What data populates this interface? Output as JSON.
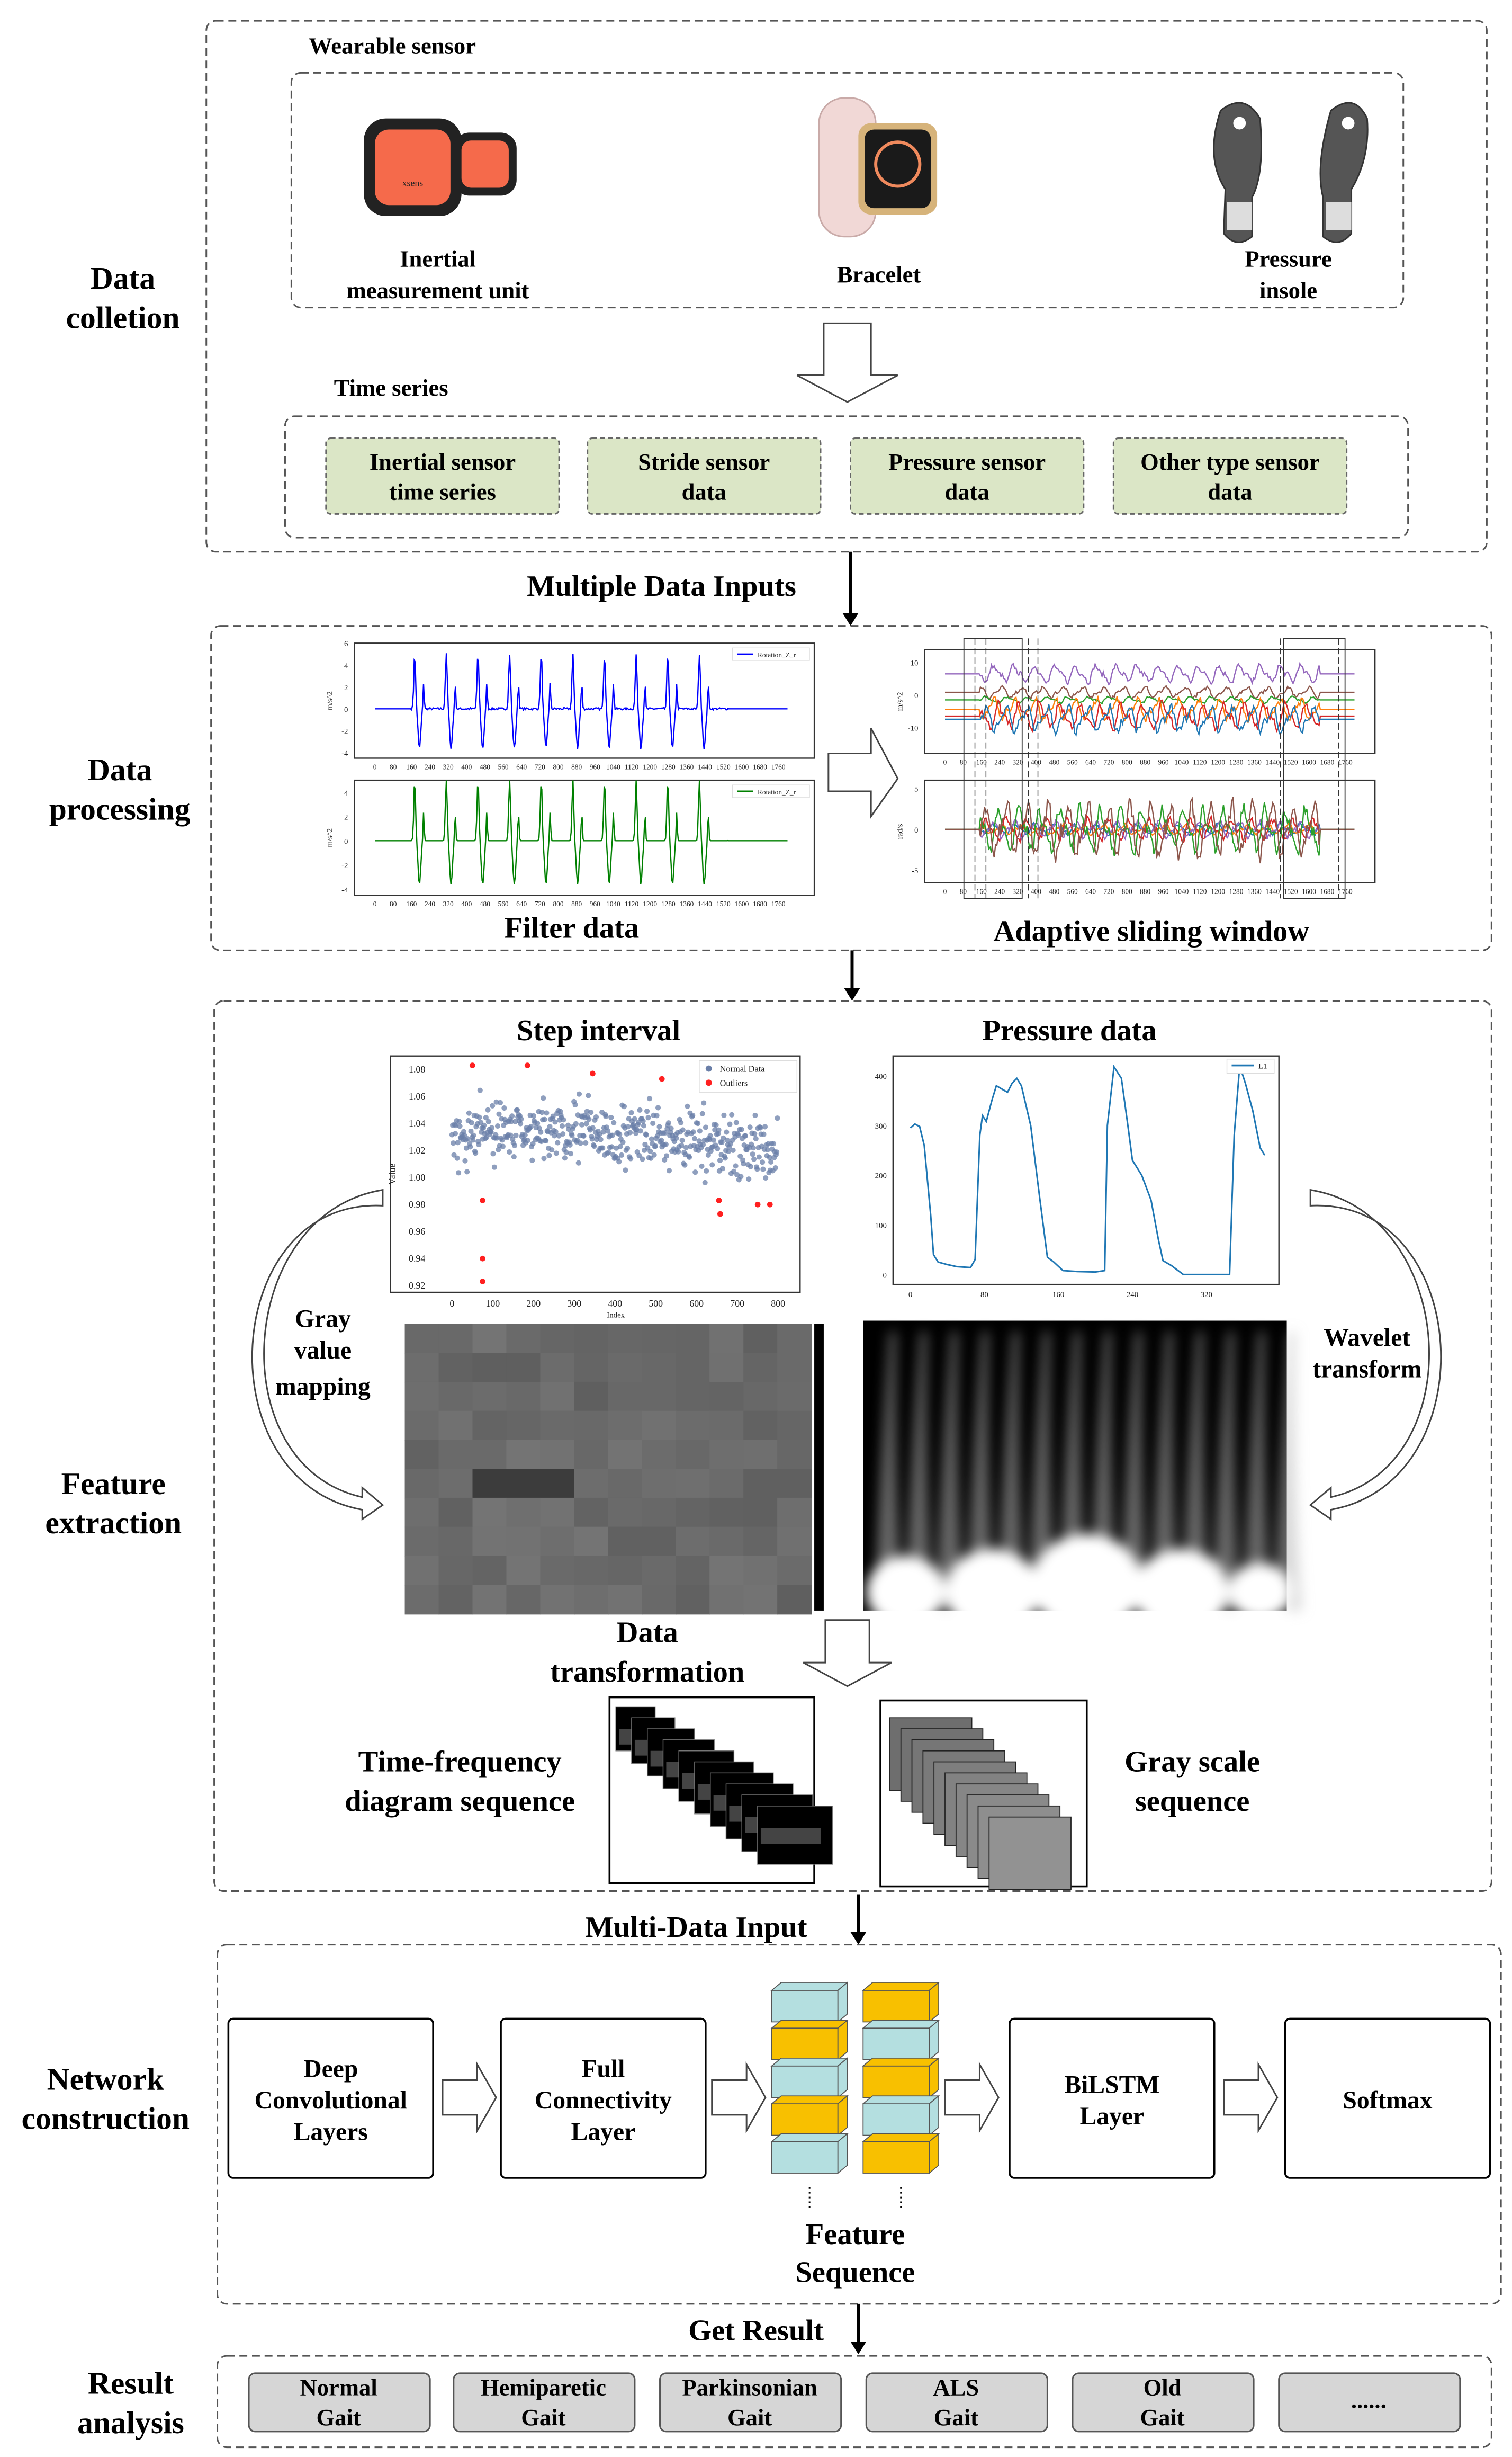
{
  "sections": {
    "collection": {
      "label": [
        "Data",
        "colletion"
      ],
      "wearable_title": "Wearable sensor",
      "time_series_title": "Time series",
      "devices": [
        {
          "icon": "imu-sensor-icon",
          "label": [
            "Inertial",
            "measurement unit"
          ],
          "brand": "xsens"
        },
        {
          "icon": "bracelet-icon",
          "label": [
            "Bracelet"
          ]
        },
        {
          "icon": "pressure-insole-icon",
          "label": [
            "Pressure",
            "insole"
          ]
        }
      ],
      "series": [
        [
          "Inertial sensor",
          "time series"
        ],
        [
          "Stride sensor",
          "data"
        ],
        [
          "Pressure sensor",
          "data"
        ],
        [
          "Other type sensor",
          "data"
        ]
      ]
    },
    "inputs_label": "Multiple Data Inputs",
    "processing": {
      "label": [
        "Data",
        "processing"
      ],
      "filter_label": "Filter data",
      "window_label": "Adaptive sliding window"
    },
    "feature": {
      "label": [
        "Feature",
        "extraction"
      ],
      "step_title": "Step interval",
      "pressure_title": "Pressure data",
      "gray_mapping": [
        "Gray",
        "value",
        "mapping"
      ],
      "wavelet": [
        "Wavelet",
        "transform"
      ],
      "transformation": [
        "Data",
        "transformation"
      ],
      "tf_sequence": [
        "Time-frequency",
        "diagram sequence"
      ],
      "gray_sequence": [
        "Gray scale",
        "sequence"
      ]
    },
    "multi_input_label": "Multi-Data Input",
    "network": {
      "label": [
        "Network",
        "construction"
      ],
      "layers": [
        [
          "Deep",
          "Convolutional",
          "Layers"
        ],
        [
          "Full",
          "Connectivity",
          "Layer"
        ],
        [
          "BiLSTM",
          "Layer"
        ],
        [
          "Softmax"
        ]
      ],
      "feature_sequence": [
        "Feature",
        "Sequence"
      ],
      "colors": {
        "cyan": "#b4dfe0",
        "yellow": "#f8c000"
      }
    },
    "get_result_label": "Get Result",
    "result": {
      "label": [
        "Result",
        "analysis"
      ],
      "gaits": [
        [
          "Normal",
          "Gait"
        ],
        [
          "Hemiparetic",
          "Gait"
        ],
        [
          "Parkinsonian",
          "Gait"
        ],
        [
          "ALS",
          "Gait"
        ],
        [
          "Old",
          "Gait"
        ],
        [
          "......"
        ]
      ]
    }
  },
  "chart_data": [
    {
      "type": "line",
      "id": "filter-raw",
      "series": [
        {
          "name": "Rotation_Z_r",
          "color": "#0000ff"
        }
      ],
      "ylabel": "m/s^2",
      "yticks": [
        "6",
        "4",
        "2",
        "0",
        "-2",
        "-4"
      ],
      "ylim": [
        -4.5,
        6
      ],
      "xlim": [
        0,
        1800
      ],
      "xticks": [
        "0",
        "80",
        "160",
        "240",
        "320",
        "400",
        "480",
        "560",
        "640",
        "720",
        "800",
        "880",
        "960",
        "1040",
        "1120",
        "1200",
        "1280",
        "1360",
        "1440",
        "1520",
        "1600",
        "1680",
        "1760"
      ]
    },
    {
      "type": "line",
      "id": "filter-smooth",
      "series": [
        {
          "name": "Rotation_Z_r",
          "color": "#008000"
        }
      ],
      "ylabel": "m/s^2",
      "yticks": [
        "4",
        "2",
        "0",
        "-2",
        "-4"
      ],
      "ylim": [
        -4.5,
        5
      ],
      "xlim": [
        0,
        1800
      ],
      "xticks": [
        "0",
        "80",
        "160",
        "240",
        "320",
        "400",
        "480",
        "560",
        "640",
        "720",
        "800",
        "880",
        "960",
        "1040",
        "1120",
        "1200",
        "1280",
        "1360",
        "1440",
        "1520",
        "1600",
        "1680",
        "1760"
      ]
    },
    {
      "type": "line",
      "id": "window-acc",
      "ylabel": "m/s^2",
      "yticks": [
        "10",
        "0",
        "-10"
      ],
      "ylim": [
        -18,
        14
      ],
      "xlim": [
        0,
        1800
      ],
      "colors": [
        "#9467bd",
        "#8c564b",
        "#2ca02c",
        "#ff7f0e",
        "#d62728",
        "#1f77b4"
      ],
      "baselines": [
        6.5,
        0.8,
        -1.5,
        -4.5,
        -6.5,
        -7.5
      ],
      "xticks": [
        "0",
        "80",
        "160",
        "240",
        "320",
        "400",
        "480",
        "560",
        "640",
        "720",
        "800",
        "880",
        "960",
        "1040",
        "1120",
        "1200",
        "1280",
        "1360",
        "1440",
        "1520",
        "1600",
        "1680",
        "1760"
      ]
    },
    {
      "type": "line",
      "id": "window-gyro",
      "ylabel": "rad/s",
      "yticks": [
        "5",
        "0",
        "-5"
      ],
      "ylim": [
        -6.5,
        6
      ],
      "xlim": [
        0,
        1800
      ],
      "colors": [
        "#1f77b4",
        "#ff7f0e",
        "#d62728",
        "#9467bd",
        "#2ca02c",
        "#8c564b"
      ],
      "xticks": [
        "0",
        "80",
        "160",
        "240",
        "320",
        "400",
        "480",
        "560",
        "640",
        "720",
        "800",
        "880",
        "960",
        "1040",
        "1120",
        "1200",
        "1280",
        "1360",
        "1440",
        "1520",
        "1600",
        "1680",
        "1760"
      ]
    },
    {
      "type": "scatter",
      "id": "step-interval",
      "xlabel": "Index",
      "ylabel": "Value",
      "legend": [
        {
          "name": "Normal Data",
          "color": "#6a7fa8"
        },
        {
          "name": "Outliers",
          "color": "#ff2020"
        }
      ],
      "xlim": [
        -40,
        850
      ],
      "ylim": [
        0.915,
        1.09
      ],
      "xticks": [
        "0",
        "100",
        "200",
        "300",
        "400",
        "500",
        "600",
        "700",
        "800"
      ],
      "yticks": [
        "1.08",
        "1.06",
        "1.04",
        "1.02",
        "1.00",
        "0.98",
        "0.96",
        "0.94",
        "0.92"
      ],
      "outliers": [
        [
          50,
          1.083
        ],
        [
          185,
          1.083
        ],
        [
          345,
          1.077
        ],
        [
          515,
          1.073
        ],
        [
          75,
          0.983
        ],
        [
          75,
          0.94
        ],
        [
          75,
          0.923
        ],
        [
          655,
          0.983
        ],
        [
          658,
          0.973
        ],
        [
          750,
          0.98
        ],
        [
          780,
          0.98
        ]
      ]
    },
    {
      "type": "line",
      "id": "pressure",
      "series": [
        {
          "name": "L1",
          "color": "#1f77b4"
        }
      ],
      "xlim": [
        -5,
        380
      ],
      "ylim": [
        -20,
        440
      ],
      "xticks": [
        "0",
        "80",
        "160",
        "240",
        "320"
      ],
      "yticks": [
        "400",
        "300",
        "200",
        "100",
        "0"
      ],
      "points": [
        [
          0,
          295
        ],
        [
          5,
          303
        ],
        [
          10,
          298
        ],
        [
          15,
          260
        ],
        [
          22,
          120
        ],
        [
          25,
          40
        ],
        [
          30,
          25
        ],
        [
          40,
          20
        ],
        [
          50,
          16
        ],
        [
          65,
          14
        ],
        [
          70,
          30
        ],
        [
          75,
          280
        ],
        [
          78,
          320
        ],
        [
          82,
          308
        ],
        [
          88,
          350
        ],
        [
          93,
          380
        ],
        [
          100,
          372
        ],
        [
          105,
          367
        ],
        [
          110,
          385
        ],
        [
          115,
          395
        ],
        [
          120,
          380
        ],
        [
          130,
          300
        ],
        [
          140,
          150
        ],
        [
          148,
          35
        ],
        [
          155,
          25
        ],
        [
          165,
          8
        ],
        [
          180,
          6
        ],
        [
          200,
          5
        ],
        [
          210,
          8
        ],
        [
          213,
          300
        ],
        [
          220,
          418
        ],
        [
          228,
          395
        ],
        [
          235,
          300
        ],
        [
          240,
          230
        ],
        [
          250,
          200
        ],
        [
          260,
          150
        ],
        [
          268,
          70
        ],
        [
          273,
          28
        ],
        [
          282,
          18
        ],
        [
          295,
          0
        ],
        [
          345,
          0
        ],
        [
          350,
          280
        ],
        [
          356,
          420
        ],
        [
          362,
          385
        ],
        [
          370,
          330
        ],
        [
          378,
          255
        ],
        [
          383,
          240
        ]
      ]
    }
  ]
}
